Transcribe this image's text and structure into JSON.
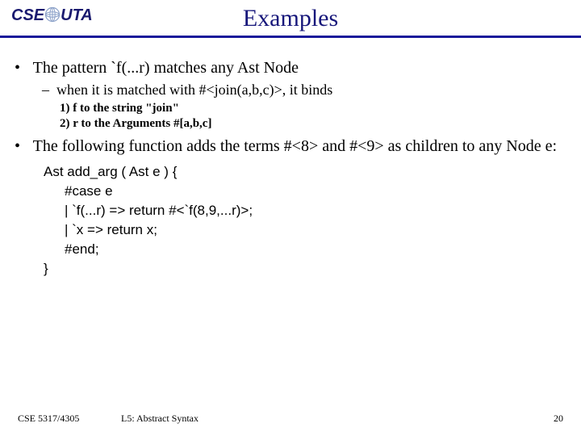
{
  "logo": {
    "left": "CSE",
    "right": "UTA"
  },
  "title": "Examples",
  "bullet1": {
    "text": "The pattern `f(...r) matches any Ast Node",
    "sub": "when it is matched with #<join(a,b,c)>, it binds",
    "subsub1": "1) f to the string \"join\"",
    "subsub2": "2) r to the Arguments #[a,b,c]"
  },
  "bullet2": {
    "text": "The following function adds the terms #<8> and #<9> as children to any Node e:",
    "code": {
      "l1": "Ast add_arg ( Ast e ) {",
      "l2": "#case e",
      "l3": "|  `f(...r) => return #<`f(8,9,...r)>;",
      "l4": "|  `x => return x;",
      "l5": "#end;",
      "l6": "}"
    }
  },
  "footer": {
    "course": "CSE 5317/4305",
    "lecture": "L5: Abstract Syntax",
    "page": "20"
  }
}
